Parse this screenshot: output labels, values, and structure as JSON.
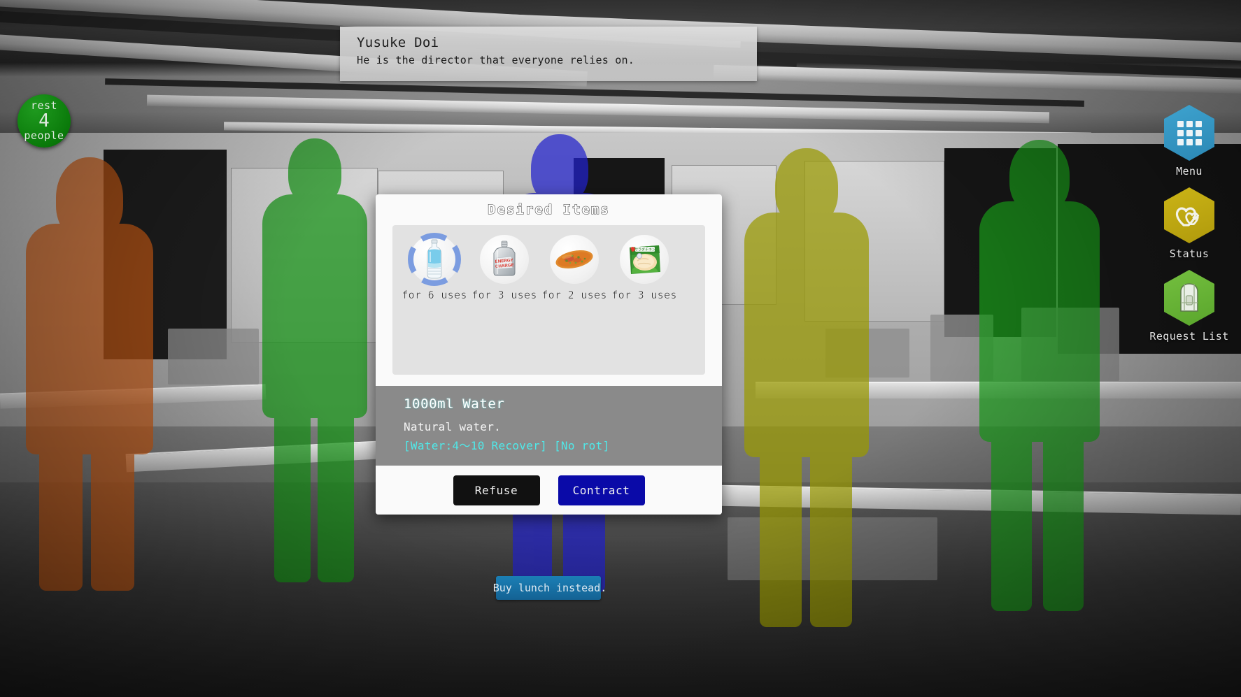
{
  "hud": {
    "rest_badge": {
      "top_label": "rest",
      "count": "4",
      "bottom_label": "people"
    },
    "character_tooltip": {
      "name": "Yusuke Doi",
      "description": "He is the director that everyone relies on."
    },
    "lunch_button_label": "Buy lunch instead."
  },
  "sidebar": {
    "items": [
      {
        "label": "Menu",
        "icon": "grid-icon",
        "color": "#3ea3cf"
      },
      {
        "label": "Status",
        "icon": "hearts-icon",
        "color": "#cbb416"
      },
      {
        "label": "Request List",
        "icon": "backpack-icon",
        "color": "#74bf3f"
      }
    ]
  },
  "dialog": {
    "title": "Desired Items",
    "items": [
      {
        "name": "1000ml Water",
        "uses_label": "for 6 uses",
        "icon": "water-bottle-icon",
        "selected": true
      },
      {
        "name": "Energy Charge Jelly",
        "uses_label": "for 3 uses",
        "icon": "jelly-pouch-icon",
        "selected": false
      },
      {
        "name": "Yakisoba Bread",
        "uses_label": "for 2 uses",
        "icon": "bread-icon",
        "selected": false
      },
      {
        "name": "Salad Chicken",
        "uses_label": "for 3 uses",
        "icon": "chicken-pack-icon",
        "selected": false
      }
    ],
    "description": {
      "name": "1000ml Water",
      "text": "Natural water.",
      "effect": "[Water:4〜10 Recover] [No rot]"
    },
    "buttons": {
      "refuse": "Refuse",
      "contract": "Contract"
    }
  },
  "colors": {
    "accent_blue": "#0a0aa8",
    "selection_ring": "#7b9ce0",
    "effect_cyan": "#4fe9e9",
    "menu_blue": "#3ea3cf",
    "status_yellow": "#cbb416",
    "request_green": "#74bf3f",
    "rest_green": "#0a7a0a"
  },
  "scene": {
    "people": [
      {
        "name": "person-orange",
        "color": "#c95a14"
      },
      {
        "name": "person-green-left",
        "color": "#169416"
      },
      {
        "name": "person-blue-center",
        "color": "#2222cc"
      },
      {
        "name": "person-yellow",
        "color": "#9a9a00"
      },
      {
        "name": "person-green-right",
        "color": "#1a9e1a"
      }
    ]
  }
}
